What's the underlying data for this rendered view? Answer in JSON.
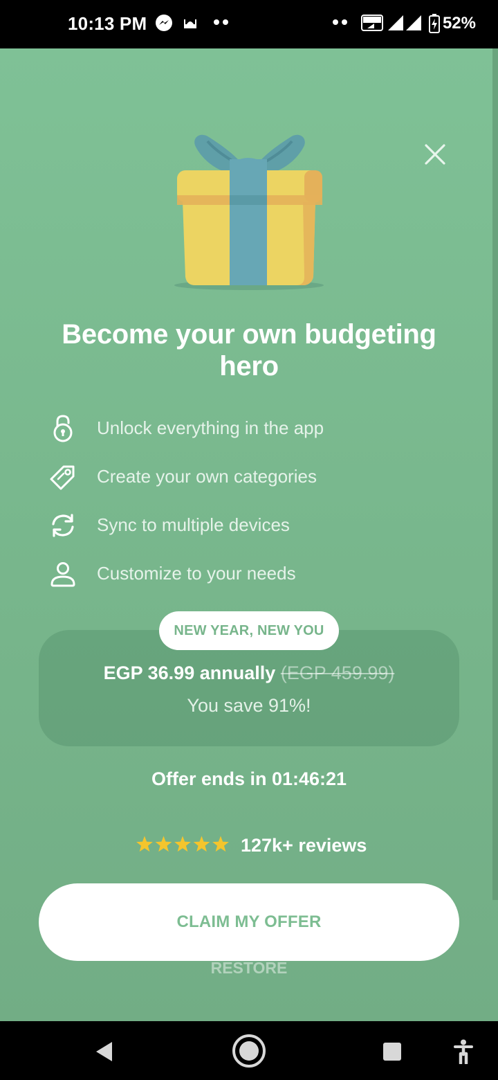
{
  "status_bar": {
    "time": "10:13 PM",
    "battery_percent": "52%",
    "icons": [
      "messenger-icon",
      "mosque-icon",
      "more-dots-icon",
      "more-dots-icon",
      "volte-icon",
      "signal-icon",
      "signal-icon",
      "battery-charging-icon"
    ]
  },
  "paywall": {
    "headline": "Become your own budgeting hero",
    "features": [
      {
        "icon": "unlock-icon",
        "label": "Unlock everything in the app"
      },
      {
        "icon": "tag-icon",
        "label": "Create your own categories"
      },
      {
        "icon": "sync-icon",
        "label": "Sync to multiple devices"
      },
      {
        "icon": "person-icon",
        "label": "Customize to your needs"
      }
    ],
    "offer": {
      "badge": "NEW YEAR, NEW YOU",
      "price_current": "EGP 36.99 annually",
      "price_original": "(EGP 459.99)",
      "savings": "You save 91%!"
    },
    "countdown": "Offer ends in 01:46:21",
    "rating": {
      "stars": 5,
      "reviews_text": "127k+ reviews"
    },
    "claim_label": "CLAIM MY OFFER",
    "restore_label": "RESTORE"
  },
  "colors": {
    "background": "#7fc196",
    "accent_text": "#77b58b",
    "star": "#f4c52d",
    "gift_box": "#ecd462",
    "gift_ribbon": "#67a7b5"
  },
  "nav_bar": {
    "icons": [
      "back-icon",
      "home-icon",
      "recents-icon",
      "accessibility-icon"
    ]
  }
}
